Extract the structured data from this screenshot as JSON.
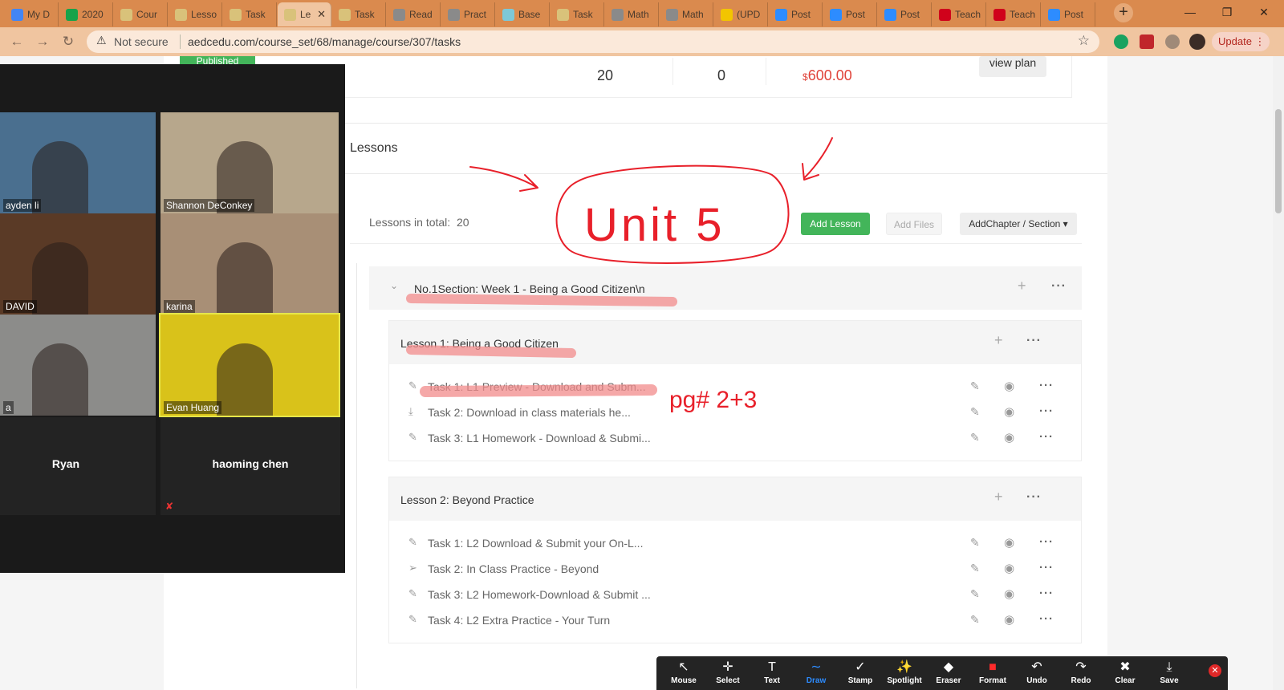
{
  "browser": {
    "tabs": [
      {
        "label": "My D",
        "color": "#4285f4"
      },
      {
        "label": "2020",
        "color": "#16a34a"
      },
      {
        "label": "Cour",
        "color": "#d9c27a"
      },
      {
        "label": "Lesso",
        "color": "#d9c27a"
      },
      {
        "label": "Task",
        "color": "#d9c27a"
      },
      {
        "label": "Le",
        "color": "#d9c27a"
      },
      {
        "label": "Task",
        "color": "#d9c27a"
      },
      {
        "label": "Read",
        "color": "#8a8a8a"
      },
      {
        "label": "Pract",
        "color": "#8a8a8a"
      },
      {
        "label": "Base",
        "color": "#7dc8d8"
      },
      {
        "label": "Task",
        "color": "#d9c27a"
      },
      {
        "label": "Math",
        "color": "#8a8a8a"
      },
      {
        "label": "Math",
        "color": "#8a8a8a"
      },
      {
        "label": "(UPD",
        "color": "#f2c500"
      },
      {
        "label": "Post",
        "color": "#2d8cff"
      },
      {
        "label": "Post",
        "color": "#2d8cff"
      },
      {
        "label": "Post",
        "color": "#2d8cff"
      },
      {
        "label": "Teach",
        "color": "#d0021b"
      },
      {
        "label": "Teach",
        "color": "#d0021b"
      },
      {
        "label": "Post",
        "color": "#2d8cff"
      }
    ],
    "not_secure": "Not secure",
    "url": "aedcedu.com/course_set/68/manage/course/307/tasks",
    "update_label": "Update"
  },
  "page": {
    "published_badge": "Published",
    "stats": {
      "count_a": "20",
      "count_b": "0",
      "price_symbol": "$",
      "price": "600.00"
    },
    "view_plan": "view plan",
    "lessons_heading": "Lessons",
    "summary": {
      "label": "Lessons in total:",
      "count": "20"
    },
    "buttons": {
      "add_lesson": "Add Lesson",
      "add_files": "Add Files",
      "add_chapter": "AddChapter / Section ▾"
    },
    "section": {
      "title": "No.1Section:  Week 1 - Being a Good Citizen\\n"
    },
    "lessons": [
      {
        "title": "Lesson 1:   Being a Good Citizen",
        "tasks": [
          {
            "icon": "✎",
            "label": "Task 1:   L1 Preview - Download and Subm..."
          },
          {
            "icon": "⤓",
            "label": "Task 2:   Download in class materials he..."
          },
          {
            "icon": "✎",
            "label": "Task 3:   L1 Homework - Download & Submi..."
          }
        ]
      },
      {
        "title": "Lesson 2:   Beyond Practice",
        "tasks": [
          {
            "icon": "✎",
            "label": "Task 1:   L2 Download & Submit your On-L..."
          },
          {
            "icon": "➢",
            "label": "Task 2:   In Class Practice - Beyond"
          },
          {
            "icon": "✎",
            "label": "Task 3:   L2 Homework-Download & Submit ..."
          },
          {
            "icon": "✎",
            "label": "Task 4:   L2 Extra Practice - Your Turn"
          }
        ]
      }
    ]
  },
  "zoom": {
    "video_tiles": [
      {
        "name": "ayden li",
        "bg": "#4a6f8f"
      },
      {
        "name": "Shannon DeConkey",
        "bg": "#b7a78c"
      },
      {
        "name": "DAVID",
        "bg": "#5a3a26"
      },
      {
        "name": "karina",
        "bg": "#a88f76"
      },
      {
        "name": "a",
        "bg": "#8c8c8a"
      },
      {
        "name": "Evan Huang",
        "bg": "#d9c21a"
      }
    ],
    "participants": [
      {
        "name": "Ryan"
      },
      {
        "name": "haoming chen"
      }
    ],
    "toolbar": [
      {
        "icon": "↖",
        "label": "Mouse"
      },
      {
        "icon": "✛",
        "label": "Select"
      },
      {
        "icon": "T",
        "label": "Text"
      },
      {
        "icon": "∼",
        "label": "Draw"
      },
      {
        "icon": "✓",
        "label": "Stamp"
      },
      {
        "icon": "✨",
        "label": "Spotlight"
      },
      {
        "icon": "◆",
        "label": "Eraser"
      },
      {
        "icon": "■",
        "label": "Format"
      },
      {
        "icon": "↶",
        "label": "Undo"
      },
      {
        "icon": "↷",
        "label": "Redo"
      },
      {
        "icon": "✖",
        "label": "Clear"
      },
      {
        "icon": "⤓",
        "label": "Save"
      }
    ]
  },
  "annotations": {
    "unit_text": "Unit 5",
    "page_note": "pg# 2+3",
    "ink_color": "#e8202a",
    "highlight_color": "#f28b8b"
  }
}
